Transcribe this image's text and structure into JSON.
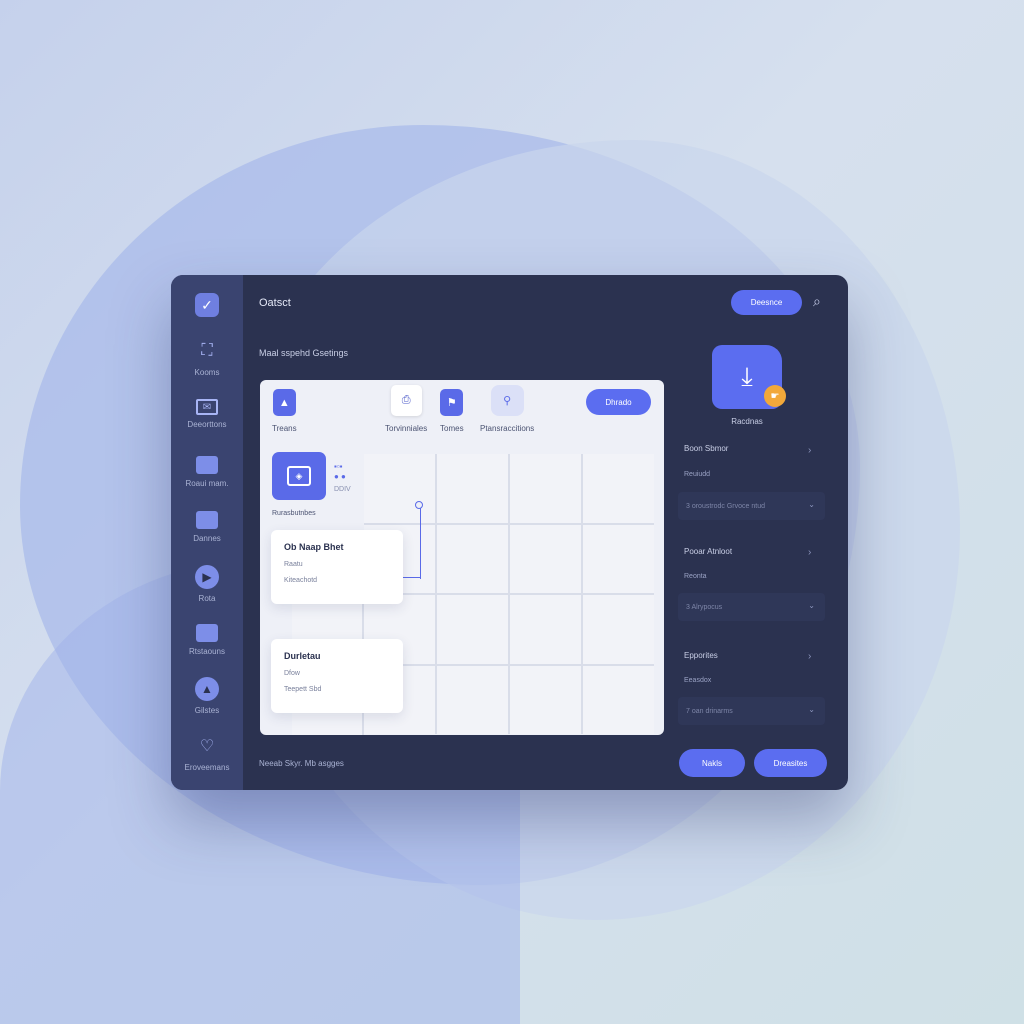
{
  "header": {
    "title": "Oatsct",
    "button_label": "Deesnce",
    "subtitle": "Maal sspehd Gsetings"
  },
  "sidebar": {
    "items": [
      {
        "label": "Kooms",
        "icon": "person-icon"
      },
      {
        "label": "Deeorttons",
        "icon": "mail-icon"
      },
      {
        "label": "Roaui mam.",
        "icon": "folder-icon"
      },
      {
        "label": "Dannes",
        "icon": "folder-icon"
      },
      {
        "label": "Rota",
        "icon": "circle-icon"
      },
      {
        "label": "Rtstaouns",
        "icon": "folder-icon"
      },
      {
        "label": "Gilstes",
        "icon": "circle-icon"
      },
      {
        "label": "Eroveemans",
        "icon": "heart-icon"
      }
    ]
  },
  "panel": {
    "tools": [
      {
        "label": "Treans",
        "icon": "triangle-icon"
      },
      {
        "label": "Torvinniales",
        "icon": "clipboard-icon"
      },
      {
        "label": "Tomes",
        "icon": "flag-icon"
      },
      {
        "label": "Ptansraccitions",
        "icon": "pin-icon"
      }
    ],
    "button_label": "Dhrado",
    "thumbnail_label": "Rurasbutnbes",
    "dots_label": "DDIV",
    "cards": [
      {
        "title": "Ob Naap Bhet",
        "line1": "Raatu",
        "line2": "Kiteachotd"
      },
      {
        "title": "Durletau",
        "line1": "Dfow",
        "line2": "Teepett Sbd"
      }
    ]
  },
  "right_panel": {
    "download_label": "Racdnas",
    "sections": [
      {
        "title": "Boon Sbmor",
        "sub": "Reuiudd",
        "select": "3 oroustrodc Grvoce ntud"
      },
      {
        "title": "Pooar Atnloot",
        "sub": "Reonta",
        "select": "3 Alrypocus"
      },
      {
        "title": "Epporites",
        "sub": "Eeasdox",
        "select": "7 oan drinarms"
      }
    ]
  },
  "footer": {
    "text": "Neeab Skyr. Mb asgges",
    "button1": "Nakls",
    "button2": "Dreasites"
  },
  "colors": {
    "accent": "#5b6df0",
    "window_bg": "#2b3250",
    "sidebar_bg": "#3a4470",
    "badge": "#f2a83a"
  }
}
